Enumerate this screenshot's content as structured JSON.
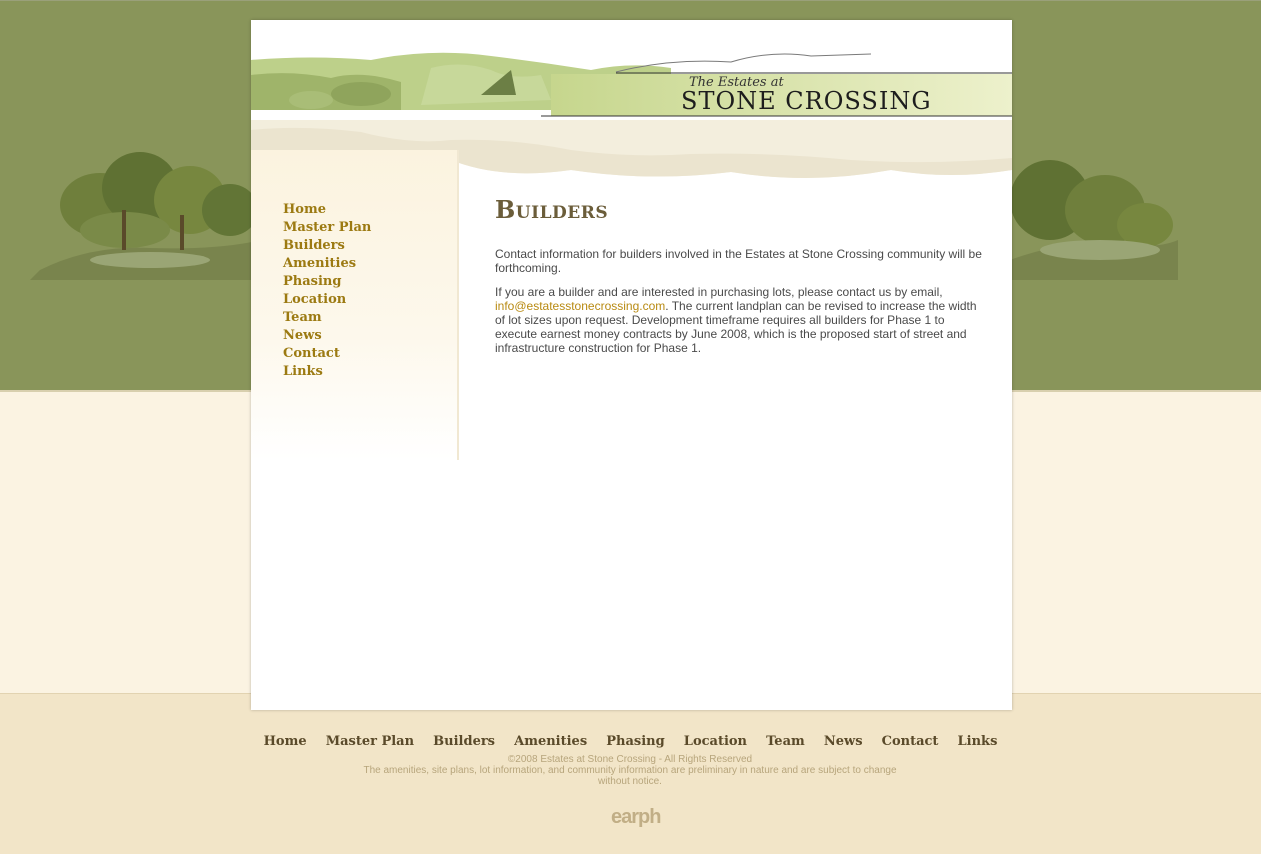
{
  "site": {
    "logo_script": "The Estates at",
    "logo_main": "STONE CROSSING"
  },
  "nav": {
    "items": [
      "Home",
      "Master Plan",
      "Builders",
      "Amenities",
      "Phasing",
      "Location",
      "Team",
      "News",
      "Contact",
      "Links"
    ]
  },
  "content": {
    "title": "Builders",
    "paragraph1": "Contact information for builders involved in the Estates at Stone Crossing community will be forthcoming.",
    "paragraph2_before": "If you are a builder and are interested in purchasing lots, please contact us by email, ",
    "email": "info@estatesstonecrossing.com",
    "paragraph2_after": ". The current landplan can be revised to increase the width of lot sizes upon request. Development timeframe requires all builders for Phase 1 to execute earnest money contracts by June 2008, which is the proposed start of street and infrastructure construction for Phase 1."
  },
  "footer": {
    "nav": [
      "Home",
      "Master Plan",
      "Builders",
      "Amenities",
      "Phasing",
      "Location",
      "Team",
      "News",
      "Contact",
      "Links"
    ],
    "copyright": "©2008 Estates at Stone Crossing - All Rights Reserved",
    "disclaimer": "The amenities, site plans, lot information, and community information are preliminary in nature and are subject to change without notice.",
    "credit": "earph"
  },
  "colors": {
    "green_band": "#89955a",
    "cream": "#fbf3e2",
    "footer_bg": "#f2e5c8",
    "nav_link": "#9c7a12",
    "title": "#6b5d3a"
  }
}
